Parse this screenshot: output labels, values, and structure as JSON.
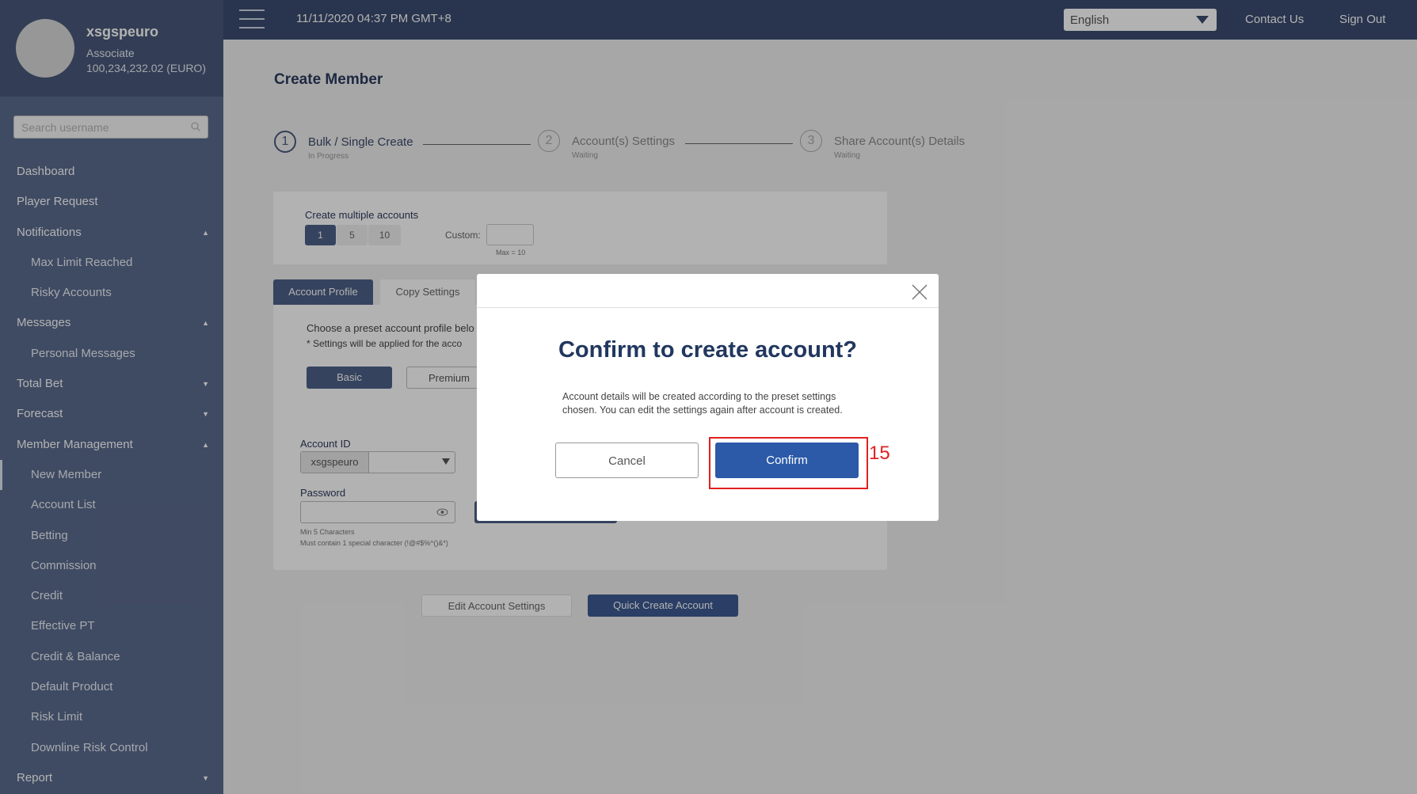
{
  "user": {
    "name": "xsgspeuro",
    "role": "Associate",
    "balance": "100,234,232.02 (EURO)"
  },
  "search": {
    "placeholder": "Search username"
  },
  "sidebar": {
    "items": [
      {
        "label": "Dashboard"
      },
      {
        "label": "Player Request"
      },
      {
        "label": "Notifications",
        "caret": "▲"
      },
      {
        "label": "Max Limit Reached"
      },
      {
        "label": "Risky Accounts"
      },
      {
        "label": "Messages",
        "caret": "▲"
      },
      {
        "label": "Personal Messages"
      },
      {
        "label": "Total Bet",
        "caret": "▼"
      },
      {
        "label": "Forecast",
        "caret": "▼"
      },
      {
        "label": "Member Management",
        "caret": "▲"
      },
      {
        "label": "New Member"
      },
      {
        "label": "Account List"
      },
      {
        "label": "Betting"
      },
      {
        "label": "Commission"
      },
      {
        "label": "Credit"
      },
      {
        "label": "Effective PT"
      },
      {
        "label": "Credit & Balance"
      },
      {
        "label": "Default Product"
      },
      {
        "label": "Risk Limit"
      },
      {
        "label": "Downline Risk Control"
      },
      {
        "label": "Report",
        "caret": "▼"
      }
    ]
  },
  "topbar": {
    "datetime": "11/11/2020 04:37 PM GMT+8",
    "language": "English",
    "contact": "Contact Us",
    "signout": "Sign Out"
  },
  "page": {
    "title": "Create Member"
  },
  "steps": [
    {
      "num": "1",
      "title": "Bulk / Single Create",
      "status": "In Progress"
    },
    {
      "num": "2",
      "title": "Account(s) Settings",
      "status": "Waiting"
    },
    {
      "num": "3",
      "title": "Share Account(s) Details",
      "status": "Waiting"
    }
  ],
  "multi": {
    "label": "Create multiple accounts",
    "options": [
      "1",
      "5",
      "10"
    ],
    "custom_label": "Custom:",
    "max_note": "Max = 10"
  },
  "tabs": {
    "profile": "Account Profile",
    "copy": "Copy Settings"
  },
  "profile": {
    "line1": "Choose a preset account profile belo",
    "line2": "* Settings will be applied for the acco",
    "basic": "Basic",
    "premium": "Premium"
  },
  "account": {
    "id_label": "Account ID",
    "id_prefix": "xsgspeuro",
    "password_label": "Password",
    "rule1": "Min 5 Characters",
    "rule2": "Must contain 1 special character (!@#$%^()&*)"
  },
  "actions": {
    "edit": "Edit Account Settings",
    "quick": "Quick Create Account"
  },
  "modal": {
    "title": "Confirm to create account?",
    "body": "Account details will be created according to the preset settings chosen. You can edit the settings again after account is created.",
    "cancel": "Cancel",
    "confirm": "Confirm"
  },
  "annotation": {
    "number": "15",
    "color": "#e02020"
  }
}
